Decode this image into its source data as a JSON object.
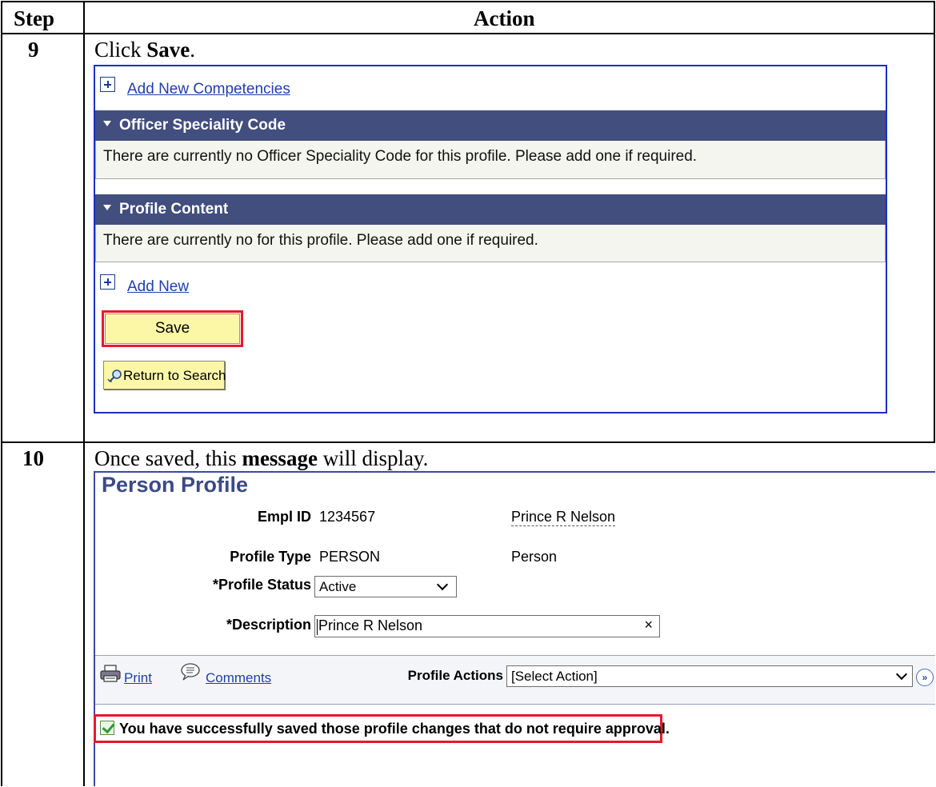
{
  "table": {
    "col_step": "Step",
    "col_action": "Action"
  },
  "step9": {
    "number": "9",
    "instruction_prefix": "Click ",
    "instruction_bold": "Save",
    "instruction_suffix": ".",
    "screen": {
      "add_competencies_link": "Add New Competencies",
      "sections": [
        {
          "title": "Officer Speciality Code",
          "body": "There are currently no Officer Speciality Code for this profile.  Please add one if required."
        },
        {
          "title": "Profile Content",
          "body": "There are currently no  for this profile.  Please add one if required."
        }
      ],
      "add_new_link": "Add New",
      "save_label": "Save",
      "return_label": "Return to Search"
    }
  },
  "step10": {
    "number": "10",
    "instruction_prefix": "Once saved, this ",
    "instruction_bold": "message",
    "instruction_suffix": " will display.",
    "screen": {
      "title": "Person Profile",
      "empl_id_label": "Empl ID",
      "empl_id_value": "1234567",
      "person_name": "Prince R Nelson",
      "profile_type_label": "Profile Type",
      "profile_type_value": "PERSON",
      "profile_type_desc": "Person",
      "status_label": "*Profile Status",
      "status_value": "Active",
      "description_label": "*Description",
      "description_value": "Prince R Nelson",
      "clear_glyph": "×",
      "print_link": "Print",
      "comments_link": "Comments",
      "actions_label": "Profile Actions",
      "actions_value": "[Select Action]",
      "go_glyph": "»",
      "success_message": "You have successfully saved those profile changes that do not require approval."
    }
  },
  "colors": {
    "screen_border": "#1c2ec4",
    "section_header": "#414e7e",
    "button_yellow": "#fbf7a7",
    "highlight_red": "#e8182a",
    "title_blue": "#3b4a86",
    "link_blue": "#1f3fa8"
  }
}
